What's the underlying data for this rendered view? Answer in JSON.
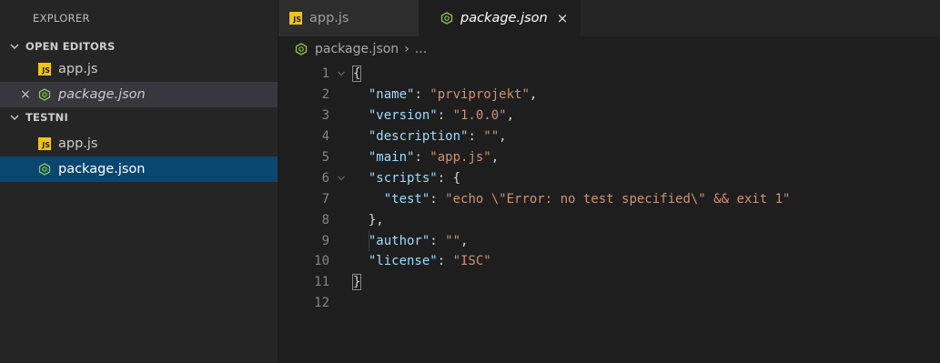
{
  "sidebar": {
    "title": "EXPLORER",
    "open_editors": {
      "header": "OPEN EDITORS",
      "items": [
        {
          "label": "app.js",
          "icon": "js-icon",
          "italic": false
        },
        {
          "label": "package.json",
          "icon": "nodejs-icon",
          "italic": true,
          "close": "×"
        }
      ]
    },
    "folder": {
      "header": "TESTNI",
      "items": [
        {
          "label": "app.js",
          "icon": "js-icon"
        },
        {
          "label": "package.json",
          "icon": "nodejs-icon"
        }
      ]
    }
  },
  "tabs": [
    {
      "label": "app.js",
      "icon": "js-icon",
      "active": false
    },
    {
      "label": "package.json",
      "icon": "nodejs-icon",
      "active": true,
      "close": "×"
    }
  ],
  "breadcrumb": {
    "file": "package.json",
    "separator": "›",
    "more": "..."
  },
  "code": {
    "line_numbers": [
      "1",
      "2",
      "3",
      "4",
      "5",
      "6",
      "7",
      "8",
      "9",
      "10",
      "11",
      "12"
    ],
    "line1": "{",
    "name_key": "\"name\"",
    "name_val": "\"prviprojekt\"",
    "version_key": "\"version\"",
    "version_val": "\"1.0.0\"",
    "description_key": "\"description\"",
    "description_val": "\"\"",
    "main_key": "\"main\"",
    "main_val": "\"app.js\"",
    "scripts_key": "\"scripts\"",
    "test_key": "\"test\"",
    "test_val": "\"echo \\\"Error: no test specified\\\" && exit 1\"",
    "scripts_close": "},",
    "author_key": "\"author\"",
    "author_val": "\"\"",
    "license_key": "\"license\"",
    "license_val": "\"ISC\"",
    "line11": "}"
  },
  "colors": {
    "editor_bg": "#1e1e1e",
    "sidebar_bg": "#252526",
    "selected_bg": "#094771",
    "key": "#9cdcfe",
    "string": "#ce9178",
    "js_icon": "#f0c31b",
    "node_icon": "#8cc84b"
  }
}
